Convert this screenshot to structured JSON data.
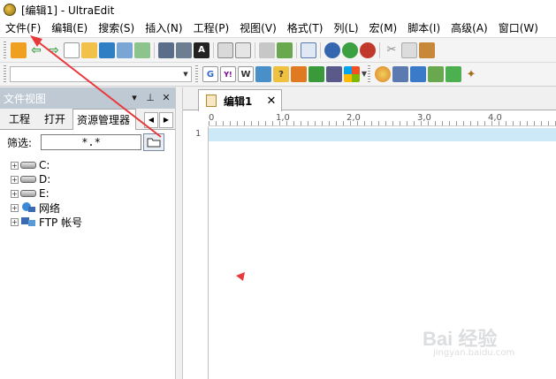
{
  "window": {
    "title": "[编辑1] - UltraEdit"
  },
  "menu": [
    "文件(F)",
    "编辑(E)",
    "搜索(S)",
    "插入(N)",
    "工程(P)",
    "视图(V)",
    "格式(T)",
    "列(L)",
    "宏(M)",
    "脚本(I)",
    "高级(A)",
    "窗口(W)"
  ],
  "toolbar1": [
    "open-icon",
    "back-icon",
    "forward-icon",
    "new-file-icon",
    "open-folder-icon",
    "save-icon",
    "save-all-icon",
    "copy-file-icon",
    "print-icon",
    "print-preview-icon",
    "font-icon",
    "wordwrap-icon",
    "format-icon",
    "hex-icon",
    "column-mode-icon",
    "list-lines-icon",
    "circle-blue-icon",
    "circle-green-icon",
    "circle-red-icon",
    "cut-icon",
    "copy-icon",
    "paste-icon"
  ],
  "toolbar2": [
    "google-icon",
    "yahoo-icon",
    "wiki-icon",
    "dict-icon",
    "help-icon",
    "html-icon",
    "css-icon",
    "php-icon",
    "windows-icon",
    "browser-icon",
    "doc-icon",
    "refresh-icon",
    "image-icon",
    "code-icon",
    "magic-icon"
  ],
  "panel": {
    "title": "文件视图",
    "tabs": [
      "工程",
      "打开",
      "资源管理器"
    ],
    "filter_label": "筛选:",
    "filter_value": "*.*",
    "tree": [
      {
        "label": "C:",
        "type": "drive"
      },
      {
        "label": "D:",
        "type": "drive"
      },
      {
        "label": "E:",
        "type": "drive"
      },
      {
        "label": "网络",
        "type": "network"
      },
      {
        "label": "FTP 帐号",
        "type": "ftp"
      }
    ]
  },
  "editor": {
    "tab_label": "编辑1",
    "ruler": [
      "0",
      "1,0",
      "2,0",
      "3,0",
      "4,0"
    ],
    "line_numbers": [
      "1"
    ]
  },
  "watermark": {
    "text": "Bai 经验",
    "sub": "jingyan.baidu.com"
  },
  "colors": {
    "accent_red": "#e8383b",
    "active_line": "#cde8f7",
    "panel_header": "#bfc9d4"
  }
}
